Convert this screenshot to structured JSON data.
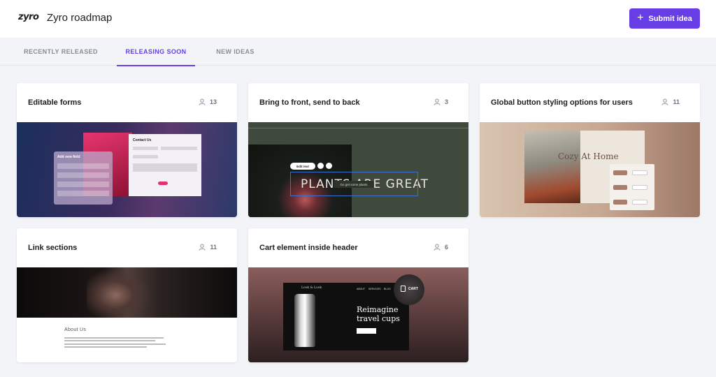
{
  "header": {
    "logo": "zyro",
    "title": "Zyro roadmap",
    "submit_label": "Submit idea"
  },
  "tabs": [
    {
      "label": "RECENTLY RELEASED",
      "active": false
    },
    {
      "label": "RELEASING SOON",
      "active": true
    },
    {
      "label": "NEW IDEAS",
      "active": false
    }
  ],
  "cards": [
    {
      "title": "Editable forms",
      "votes": "13"
    },
    {
      "title": "Bring to front, send to back",
      "votes": "3"
    },
    {
      "title": "Global button styling options for users",
      "votes": "11"
    },
    {
      "title": "Link sections",
      "votes": "11"
    },
    {
      "title": "Cart element inside header",
      "votes": "6"
    }
  ],
  "previews": {
    "forms": {
      "contact_title": "Contact Us",
      "panel_title": "Add new field"
    },
    "front": {
      "headline": "PLANTS ARE GREAT",
      "edit_label": "Edit text",
      "pill_label": "Go get some plants"
    },
    "global": {
      "headline": "Cozy At Home"
    },
    "link": {
      "about_title": "About Us"
    },
    "cart": {
      "brand": "Look & Look",
      "nav_about": "ABOUT",
      "nav_services": "SERVICES",
      "nav_blog": "BLOG",
      "cart_label": "CART",
      "headline_line1": "Reimagine",
      "headline_line2": "travel cups"
    }
  },
  "colors": {
    "accent": "#673de6",
    "background": "#f3f4f7"
  }
}
